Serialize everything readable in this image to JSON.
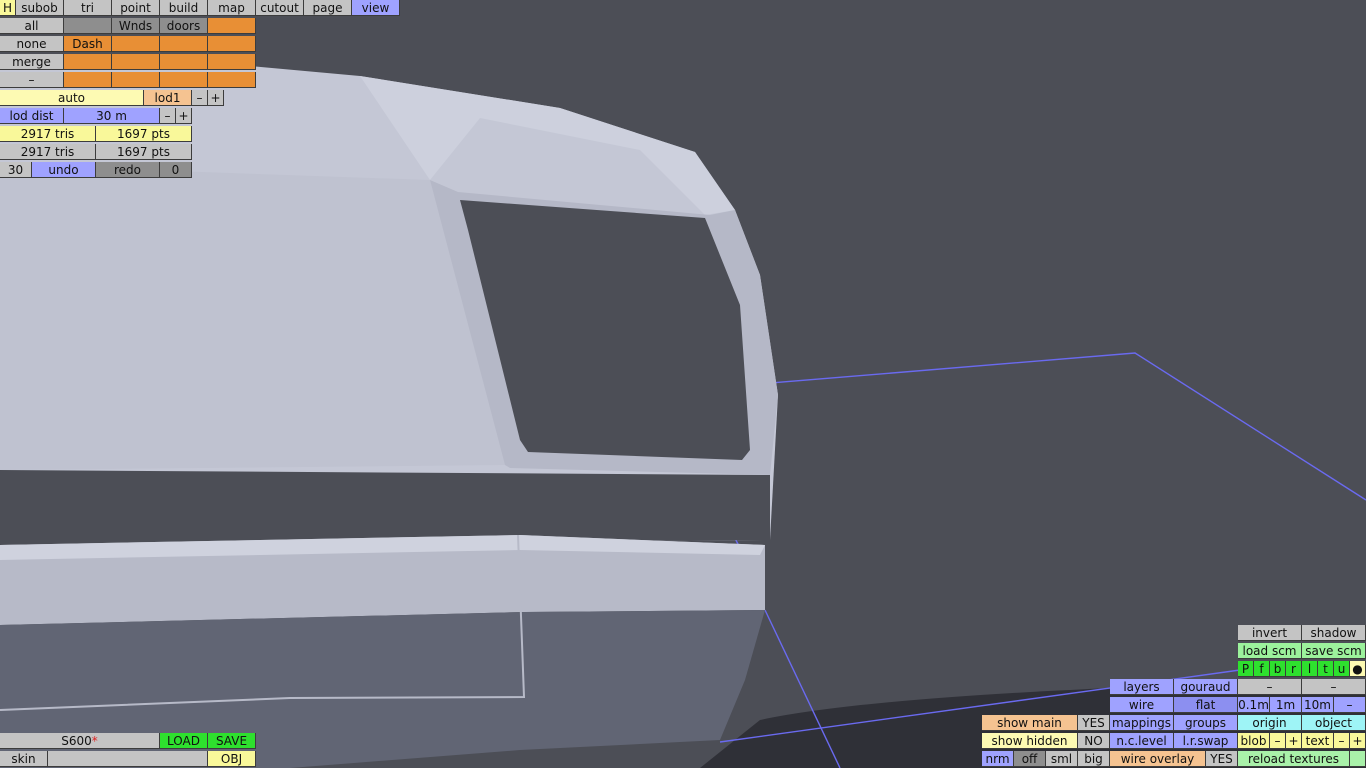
{
  "menu": [
    "H",
    "subob",
    "tri",
    "point",
    "build",
    "map",
    "cutout",
    "page",
    "view"
  ],
  "subob": {
    "row1": [
      "all",
      "",
      "Wnds",
      "doors",
      ""
    ],
    "row2": [
      "none",
      "Dash",
      "",
      "",
      ""
    ],
    "row3": [
      "merge",
      "",
      "",
      "",
      ""
    ],
    "row4": [
      "–",
      "",
      "",
      "",
      ""
    ]
  },
  "lod": {
    "auto": "auto",
    "level": "lod1",
    "minus": "–",
    "plus": "+",
    "dist_label": "lod dist",
    "dist_value": "30 m"
  },
  "stats": {
    "tris1": "2917 tris",
    "pts1": "1697 pts",
    "tris2": "2917 tris",
    "pts2": "1697 pts"
  },
  "undo": {
    "count": "30",
    "undo": "undo",
    "redo": "redo",
    "redo_count": "0"
  },
  "file": {
    "name": "S600",
    "modified": "*",
    "load": "LOAD",
    "save": "SAVE",
    "skin": "skin",
    "skin_value": "",
    "obj": "OBJ"
  },
  "view": {
    "invert": "invert",
    "shadow": "shadow",
    "load_scm": "load scm",
    "save_scm": "save scm",
    "axes": [
      "P",
      "f",
      "b",
      "r",
      "l",
      "t",
      "u",
      "●"
    ],
    "dash": "–",
    "scale": [
      "0.1m",
      "1m",
      "10m",
      "–"
    ],
    "layers": "layers",
    "gouraud": "gouraud",
    "wire": "wire",
    "flat": "flat",
    "show_main": "show main",
    "show_main_val": "YES",
    "mappings": "mappings",
    "groups": "groups",
    "origin": "origin",
    "object": "object",
    "show_hidden": "show hidden",
    "show_hidden_val": "NO",
    "nc_level": "n.c.level",
    "lr_swap": "l.r.swap",
    "blob": "blob",
    "text": "text",
    "minus": "–",
    "plus": "+",
    "nrm": "nrm",
    "off": "off",
    "sml": "sml",
    "big": "big",
    "wire_overlay": "wire overlay",
    "wire_overlay_val": "YES",
    "reload": "reload textures"
  },
  "colors": {
    "background": "#4c4e56",
    "model": "#c3c6d4",
    "wire": "#6a6af0",
    "button_blue": "#9fa2ff",
    "button_orange": "#e88f35"
  }
}
